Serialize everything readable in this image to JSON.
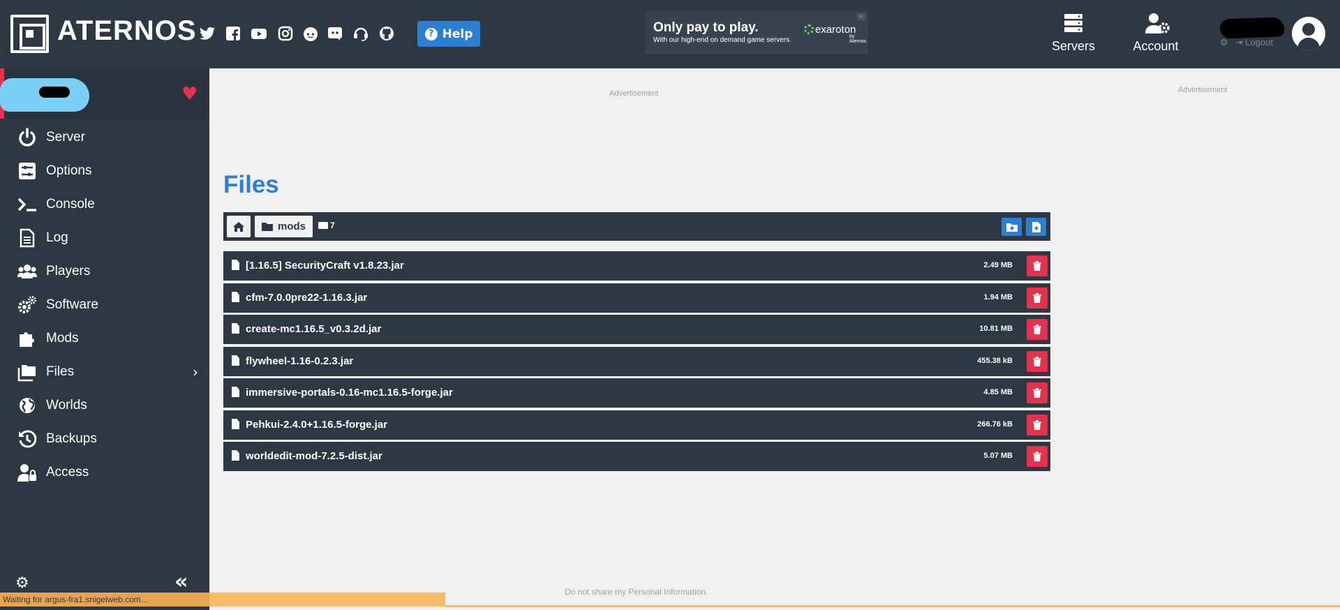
{
  "header": {
    "brand": "ATERNOS",
    "help_label": "Help",
    "servers_label": "Servers",
    "account_label": "Account",
    "logout_label": "Logout",
    "social_icons": [
      "twitter-icon",
      "facebook-icon",
      "youtube-icon",
      "instagram-icon",
      "reddit-icon",
      "discord-icon",
      "support-headset-icon",
      "github-icon"
    ]
  },
  "ad_banner": {
    "title": "Only pay to play.",
    "subtitle": "With our high-end on demand game servers.",
    "logo_text": "exaroton",
    "logo_by": "by Aternos"
  },
  "sidebar": {
    "items": [
      {
        "label": "Server",
        "icon": "power-icon"
      },
      {
        "label": "Options",
        "icon": "sliders-icon"
      },
      {
        "label": "Console",
        "icon": "terminal-icon"
      },
      {
        "label": "Log",
        "icon": "document-icon"
      },
      {
        "label": "Players",
        "icon": "users-icon"
      },
      {
        "label": "Software",
        "icon": "gears-icon"
      },
      {
        "label": "Mods",
        "icon": "puzzle-icon"
      },
      {
        "label": "Files",
        "icon": "folders-icon"
      },
      {
        "label": "Worlds",
        "icon": "globe-icon"
      },
      {
        "label": "Backups",
        "icon": "history-icon"
      },
      {
        "label": "Access",
        "icon": "user-lock-icon"
      }
    ]
  },
  "main": {
    "ad_label_left": "Advertisement",
    "ad_label_right": "Advertisement",
    "title": "Files",
    "breadcrumb_folder": "mods",
    "folder_count": "7",
    "files": [
      {
        "name": "[1.16.5] SecurityCraft v1.8.23.jar",
        "size": "2.49 MB"
      },
      {
        "name": "cfm-7.0.0pre22-1.16.3.jar",
        "size": "1.94 MB"
      },
      {
        "name": "create-mc1.16.5_v0.3.2d.jar",
        "size": "10.81 MB"
      },
      {
        "name": "flywheel-1.16-0.2.3.jar",
        "size": "455.38 kB"
      },
      {
        "name": "immersive-portals-0.16-mc1.16.5-forge.jar",
        "size": "4.85 MB"
      },
      {
        "name": "Pehkui-2.4.0+1.16.5-forge.jar",
        "size": "266.76 kB"
      },
      {
        "name": "worldedit-mod-7.2.5-dist.jar",
        "size": "5.07 MB"
      }
    ],
    "privacy_text": "Do not share my Personal Information."
  },
  "status": {
    "text": "Waiting for argus-fra1.snigelweb.com..."
  },
  "colors": {
    "header_bg": "#2d3843",
    "accent_blue": "#2b80d3",
    "danger_red": "#e8304f",
    "page_bg": "#f0f0f0"
  }
}
